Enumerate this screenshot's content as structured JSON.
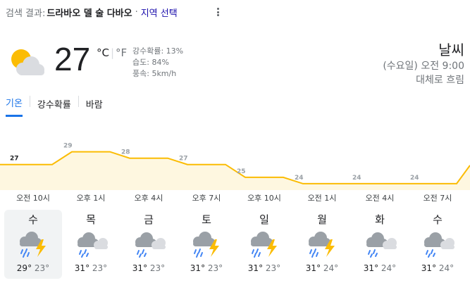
{
  "search": {
    "prefix": "검색 결과:",
    "location": "드라바오 델 술 다바오",
    "separator": "·",
    "region_link": "지역 선택"
  },
  "current": {
    "temp": "27",
    "unit_c": "°C",
    "unit_sep": "|",
    "unit_f": "°F",
    "precip": "강수확률: 13%",
    "humidity": "습도: 84%",
    "wind": "풍속: 5km/h",
    "icon": "partly-cloudy-icon"
  },
  "header": {
    "title": "날씨",
    "datetime": "(수요일) 오전 9:00",
    "condition": "대체로 흐림"
  },
  "tabs": [
    {
      "label": "기온",
      "active": true
    },
    {
      "label": "강수확률",
      "active": false
    },
    {
      "label": "바람",
      "active": false
    }
  ],
  "chart_data": {
    "type": "area",
    "x": [
      "오전 10시",
      "오후 1시",
      "오후 4시",
      "오후 7시",
      "오후 10시",
      "오전 1시",
      "오전 4시",
      "오전 7시"
    ],
    "series": [
      {
        "values": [
          27,
          29,
          28,
          27,
          25,
          24,
          24,
          24
        ]
      }
    ],
    "colors": {
      "line": "#fbbc04",
      "fill": "#fef7e0"
    }
  },
  "days": [
    {
      "name": "수",
      "high": "29°",
      "low": "23°",
      "icon": "thunderstorm-icon",
      "selected": true
    },
    {
      "name": "목",
      "high": "31°",
      "low": "23°",
      "icon": "cloud-rain-icon",
      "selected": false
    },
    {
      "name": "금",
      "high": "31°",
      "low": "23°",
      "icon": "cloud-rain-icon",
      "selected": false
    },
    {
      "name": "토",
      "high": "31°",
      "low": "23°",
      "icon": "thunderstorm-icon",
      "selected": false
    },
    {
      "name": "일",
      "high": "31°",
      "low": "23°",
      "icon": "thunderstorm-icon",
      "selected": false
    },
    {
      "name": "월",
      "high": "31°",
      "low": "24°",
      "icon": "thunderstorm-icon",
      "selected": false
    },
    {
      "name": "화",
      "high": "31°",
      "low": "24°",
      "icon": "cloud-rain-icon",
      "selected": false
    },
    {
      "name": "수",
      "high": "31°",
      "low": "24°",
      "icon": "cloud-rain-icon",
      "selected": false
    }
  ]
}
